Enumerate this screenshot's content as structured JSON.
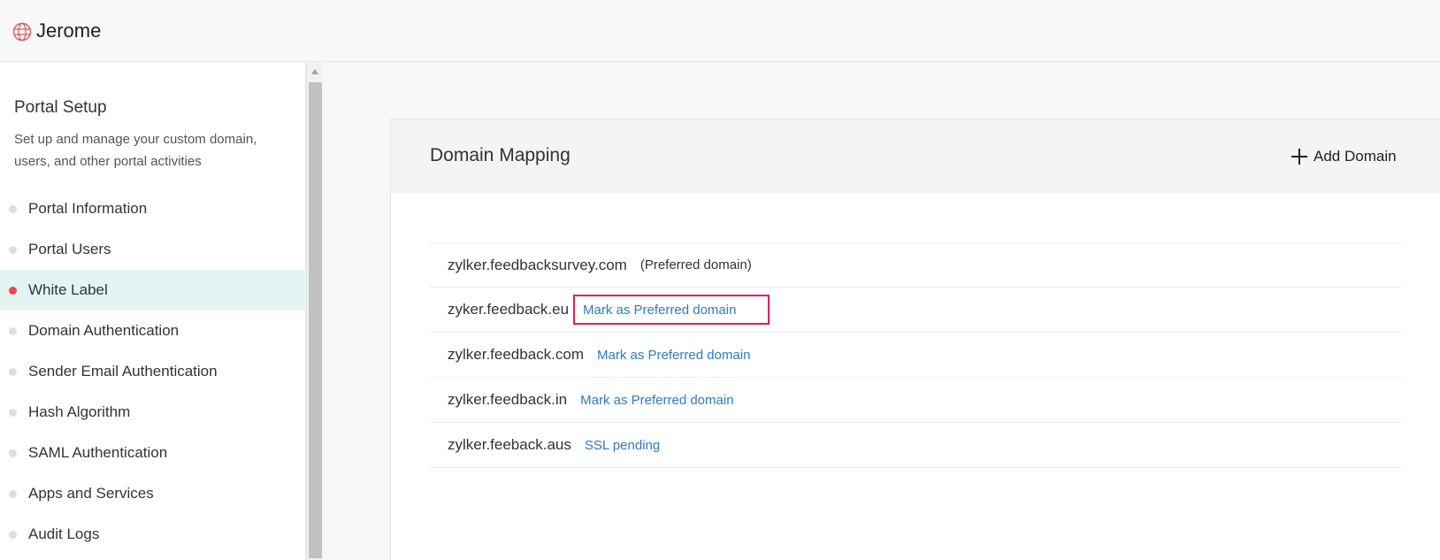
{
  "header": {
    "app_title": "Jerome",
    "logo_icon": "globe-icon",
    "logo_color": "#e05555"
  },
  "sidebar": {
    "heading": "Portal Setup",
    "description": "Set up and manage your custom domain, users, and other portal activities",
    "items": [
      {
        "label": "Portal Information",
        "active": false
      },
      {
        "label": "Portal Users",
        "active": false
      },
      {
        "label": "White Label",
        "active": true
      },
      {
        "label": "Domain Authentication",
        "active": false
      },
      {
        "label": "Sender Email Authentication",
        "active": false
      },
      {
        "label": "Hash Algorithm",
        "active": false
      },
      {
        "label": "SAML Authentication",
        "active": false
      },
      {
        "label": "Apps and Services",
        "active": false
      },
      {
        "label": "Audit Logs",
        "active": false
      }
    ]
  },
  "main": {
    "title": "Domain Mapping",
    "add_button_label": "Add Domain",
    "domains": [
      {
        "name": "zylker.feedbacksurvey.com",
        "status": "(Preferred domain)",
        "action": null
      },
      {
        "name": "zyker.feedback.eu",
        "status": null,
        "action": "Mark as Preferred domain",
        "highlighted": true
      },
      {
        "name": "zylker.feedback.com",
        "status": null,
        "action": "Mark as Preferred domain"
      },
      {
        "name": "zylker.feedback.in",
        "status": null,
        "action": "Mark as Preferred domain"
      },
      {
        "name": "zylker.feeback.aus",
        "status": null,
        "action": "SSL pending"
      }
    ]
  },
  "colors": {
    "accent_link": "#2d7bc6",
    "active_dot": "#ec4a4a",
    "active_bg": "#e3f4f3",
    "highlight_border": "#e8175d"
  }
}
